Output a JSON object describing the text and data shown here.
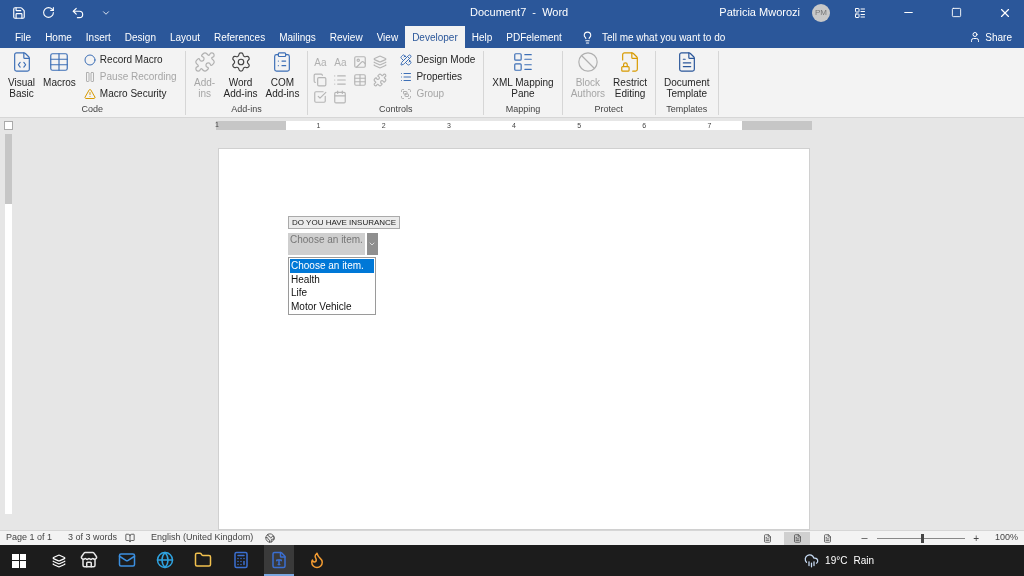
{
  "title_bar": {
    "title": "Document7  -  Word",
    "user": "Patricia Mworozi",
    "avatar": "PM"
  },
  "tabs": [
    {
      "label": "File",
      "selected": false
    },
    {
      "label": "Home",
      "selected": false
    },
    {
      "label": "Insert",
      "selected": false
    },
    {
      "label": "Design",
      "selected": false
    },
    {
      "label": "Layout",
      "selected": false
    },
    {
      "label": "References",
      "selected": false
    },
    {
      "label": "Mailings",
      "selected": false
    },
    {
      "label": "Review",
      "selected": false
    },
    {
      "label": "View",
      "selected": false
    },
    {
      "label": "Developer",
      "selected": true
    },
    {
      "label": "Help",
      "selected": false
    },
    {
      "label": "PDFelement",
      "selected": false
    }
  ],
  "tell_me": "Tell me what you want to do",
  "share": "Share",
  "ribbon": [
    {
      "label": "Code",
      "items": [
        {
          "kind": "large",
          "lines": [
            "Visual",
            "Basic"
          ],
          "disabled": false
        },
        {
          "kind": "large",
          "lines": [
            "Macros"
          ],
          "disabled": false
        },
        {
          "kind": "small",
          "label": "Record Macro",
          "disabled": false
        },
        {
          "kind": "small",
          "label": "Pause Recording",
          "disabled": true
        },
        {
          "kind": "small",
          "label": "Macro Security",
          "disabled": false
        }
      ]
    },
    {
      "label": "Add-ins",
      "items": [
        {
          "kind": "large",
          "lines": [
            "Add-",
            "ins"
          ],
          "disabled": true
        },
        {
          "kind": "large",
          "lines": [
            "Word",
            "Add-ins"
          ],
          "disabled": false
        },
        {
          "kind": "large",
          "lines": [
            "COM",
            "Add-ins"
          ],
          "disabled": false
        }
      ]
    },
    {
      "label": "Controls",
      "items": [
        {
          "kind": "grid",
          "cells": [
            {
              "kind": "text",
              "label": "Aa"
            },
            {
              "kind": "text",
              "label": "Aa"
            },
            {
              "kind": "icon"
            },
            {
              "kind": "icon"
            },
            {
              "kind": "icon"
            },
            {
              "kind": "icon"
            },
            {
              "kind": "icon"
            },
            {
              "kind": "icon"
            },
            {
              "kind": "icon"
            },
            {
              "kind": "icon"
            }
          ]
        },
        {
          "kind": "small",
          "label": "Design Mode",
          "disabled": false
        },
        {
          "kind": "small",
          "label": "Properties",
          "disabled": false
        },
        {
          "kind": "small",
          "label": "Group",
          "disabled": true
        }
      ]
    },
    {
      "label": "Mapping",
      "items": [
        {
          "kind": "large",
          "lines": [
            "XML Mapping",
            "Pane"
          ],
          "disabled": false
        }
      ]
    },
    {
      "label": "Protect",
      "items": [
        {
          "kind": "large",
          "lines": [
            "Block",
            "Authors"
          ],
          "disabled": true
        },
        {
          "kind": "large",
          "lines": [
            "Restrict",
            "Editing"
          ],
          "disabled": false
        }
      ]
    },
    {
      "label": "Templates",
      "items": [
        {
          "kind": "large",
          "lines": [
            "Document",
            "Template"
          ],
          "disabled": false
        }
      ]
    }
  ],
  "ruler": [
    "1",
    "1",
    "2",
    "3",
    "4",
    "5",
    "6",
    "7"
  ],
  "document": {
    "control_title": "DO YOU HAVE INSURANCE",
    "value": "Choose an item.",
    "options": [
      {
        "label": "Choose an item.",
        "selected": true
      },
      {
        "label": "Health",
        "selected": false
      },
      {
        "label": "Life",
        "selected": false
      },
      {
        "label": "Motor Vehicle",
        "selected": false
      }
    ]
  },
  "status_bar": {
    "page": "Page 1 of 1",
    "words": "3 of 3 words",
    "language": "English (United Kingdom)",
    "views": [
      {
        "selected": false
      },
      {
        "selected": true
      },
      {
        "selected": false
      }
    ],
    "zoom": {
      "level": 0.5
    },
    "zoom_in": "+",
    "zoom_text": "100%"
  },
  "taskbar": {
    "apps": [
      {
        "active": false
      },
      {
        "active": false
      },
      {
        "active": false
      },
      {
        "active": false
      },
      {
        "active": false
      },
      {
        "active": true
      },
      {
        "active": false
      }
    ],
    "temperature": "19°C",
    "weather": "Rain"
  }
}
